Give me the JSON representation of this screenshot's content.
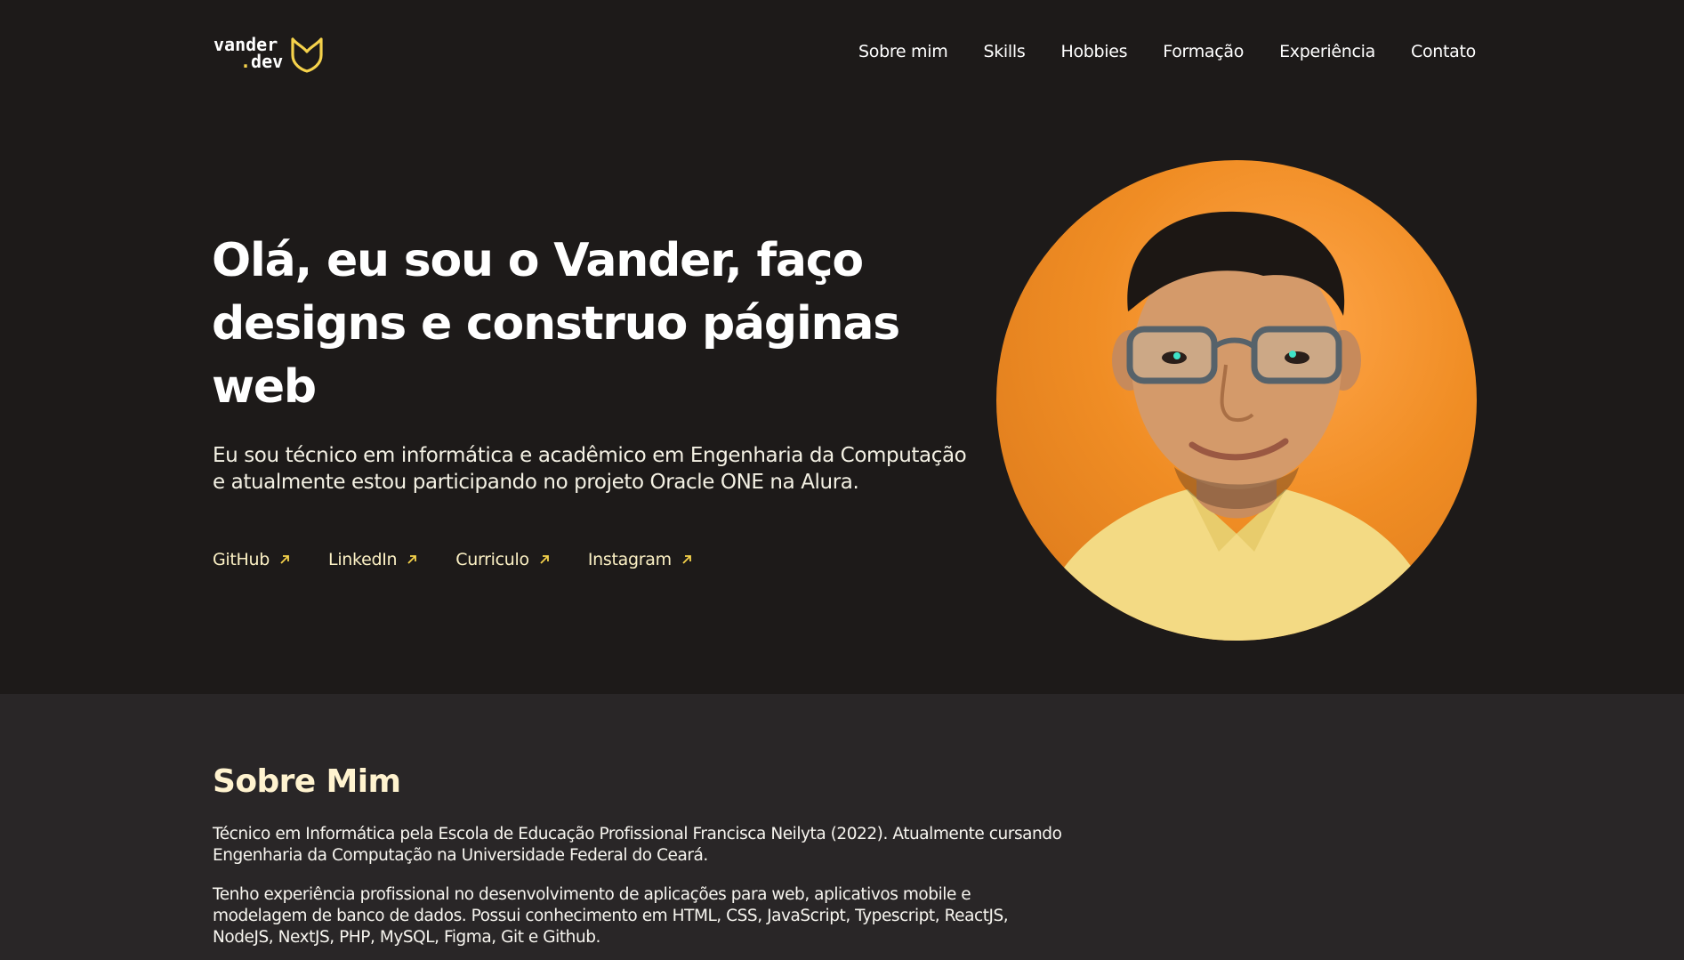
{
  "header": {
    "logo": {
      "line1": "vander",
      "line2_dot": ".",
      "line2": "dev",
      "icon": "shield-heart-icon"
    },
    "nav": [
      "Sobre mim",
      "Skills",
      "Hobbies",
      "Formação",
      "Experiência",
      "Contato"
    ]
  },
  "hero": {
    "title": "Olá, eu sou o Vander, faço designs e construo páginas web",
    "description": "Eu sou técnico em informática e acadêmico em Engenharia da Computação e atualmente estou participando no projeto Oracle ONE na Alura.",
    "links": [
      {
        "label": "GitHub",
        "icon": "arrow-up-right-icon"
      },
      {
        "label": "LinkedIn",
        "icon": "arrow-up-right-icon"
      },
      {
        "label": "Curriculo",
        "icon": "arrow-up-right-icon"
      },
      {
        "label": "Instagram",
        "icon": "arrow-up-right-icon"
      }
    ]
  },
  "about": {
    "title": "Sobre Mim",
    "paragraphs": [
      "Técnico em Informática pela Escola de Educação Profissional Francisca Neilyta (2022). Atualmente cursando Engenharia da Computação na Universidade Federal do Ceará.",
      "Tenho experiência profissional no desenvolvimento de aplicações para web, aplicativos mobile e modelagem de banco de dados. Possui conhecimento em HTML, CSS, JavaScript, Typescript, ReactJS, NodeJS, NextJS, PHP, MySQL, Figma, Git e Github."
    ]
  },
  "colors": {
    "background": "#1d1a19",
    "section_background": "#292627",
    "accent": "#f5d24b",
    "avatar_background": "#f08d24"
  }
}
